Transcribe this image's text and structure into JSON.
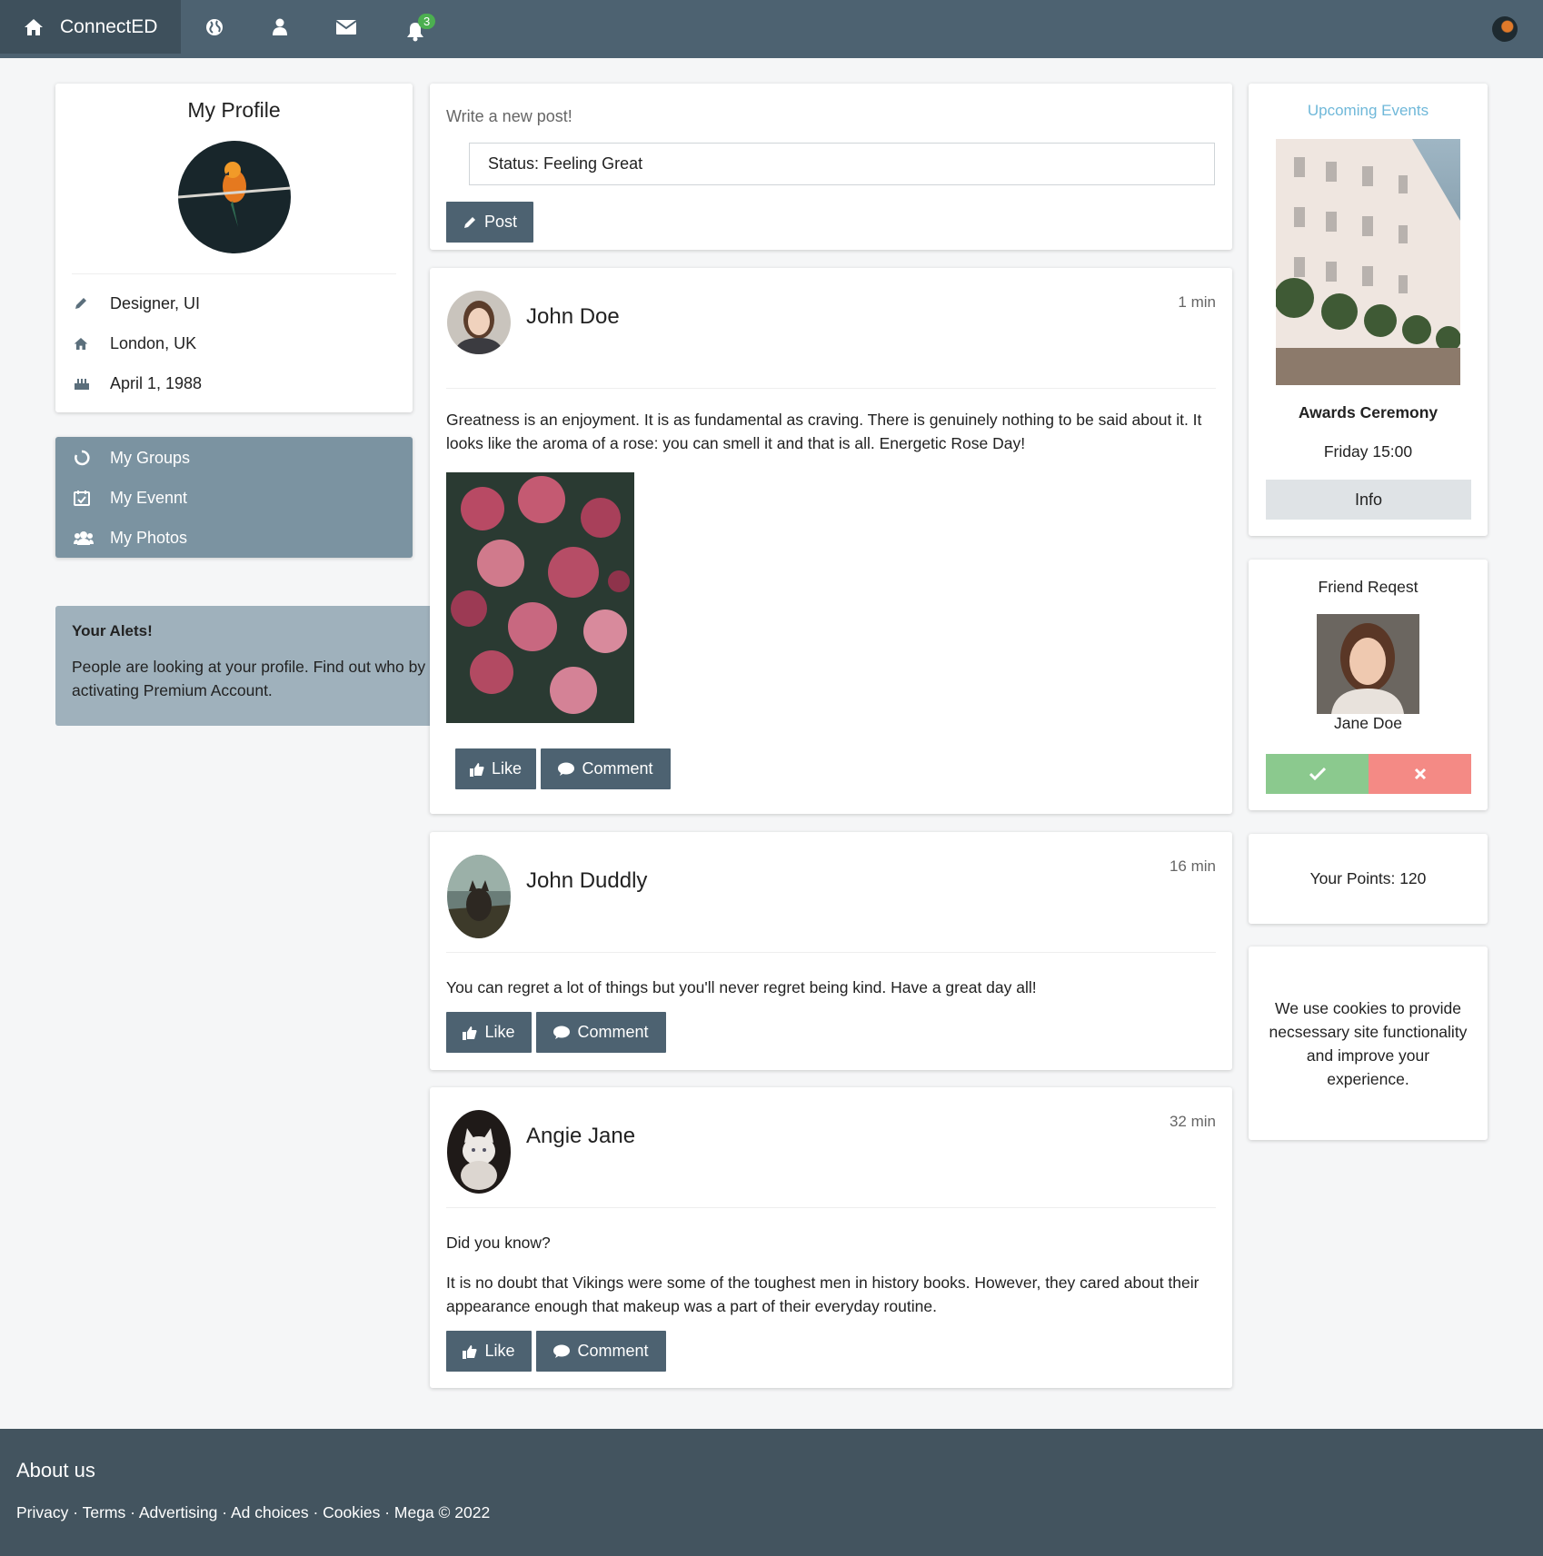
{
  "nav": {
    "brand": "ConnectED",
    "notification_count": "3",
    "icons": [
      "home-icon",
      "globe-icon",
      "user-icon",
      "envelope-icon",
      "bell-icon"
    ]
  },
  "profile": {
    "title": "My Profile",
    "job": "Designer, UI",
    "location": "London, UK",
    "birthday": "April 1, 1988"
  },
  "menu": {
    "groups": "My Groups",
    "events": "My Evennt",
    "photos": "My Photos"
  },
  "alert": {
    "title": "Your Alets!",
    "text": "People are looking at your profile. Find out who by activating Premium Account."
  },
  "composer": {
    "prompt": "Write a new post!",
    "status_value": "Status: Feeling Great",
    "post_label": "Post"
  },
  "posts": [
    {
      "author": "John Doe",
      "time": "1 min",
      "text": "Greatness is an enjoyment. It is as fundamental as craving. There is genuinely nothing to be said about it. It looks like the aroma of a rose: you can smell it and that is all. Energetic Rose Day!",
      "like": "Like",
      "comment": "Comment"
    },
    {
      "author": "John Duddly",
      "time": "16 min",
      "text": "You can regret a lot of things but you'll never regret being kind. Have a great day all!",
      "like": "Like",
      "comment": "Comment"
    },
    {
      "author": "Angie Jane",
      "time": "32 min",
      "text1": "Did you know?",
      "text2": "It is no doubt that Vikings were some of the toughest men in history books. However, they cared about their appearance enough that makeup was a part of their everyday routine.",
      "like": "Like",
      "comment": "Comment"
    }
  ],
  "events": {
    "heading": "Upcoming Events",
    "name": "Awards Ceremony",
    "time": "Friday 15:00",
    "info_label": "Info"
  },
  "friend_request": {
    "heading": "Friend Reqest",
    "name": "Jane Doe"
  },
  "points": {
    "text": "Your Points: 120"
  },
  "cookies": {
    "text": "We use cookies to provide necsessary site functionality and improve your experience."
  },
  "footer": {
    "title": "About us",
    "links": "Privacy · Terms · Advertising · Ad choices · Cookies · Mega © 2022"
  },
  "colors": {
    "nav": "#4d6271",
    "accept": "#8bc98e",
    "decline": "#f48a85",
    "event_heading": "#6fb8d9"
  }
}
